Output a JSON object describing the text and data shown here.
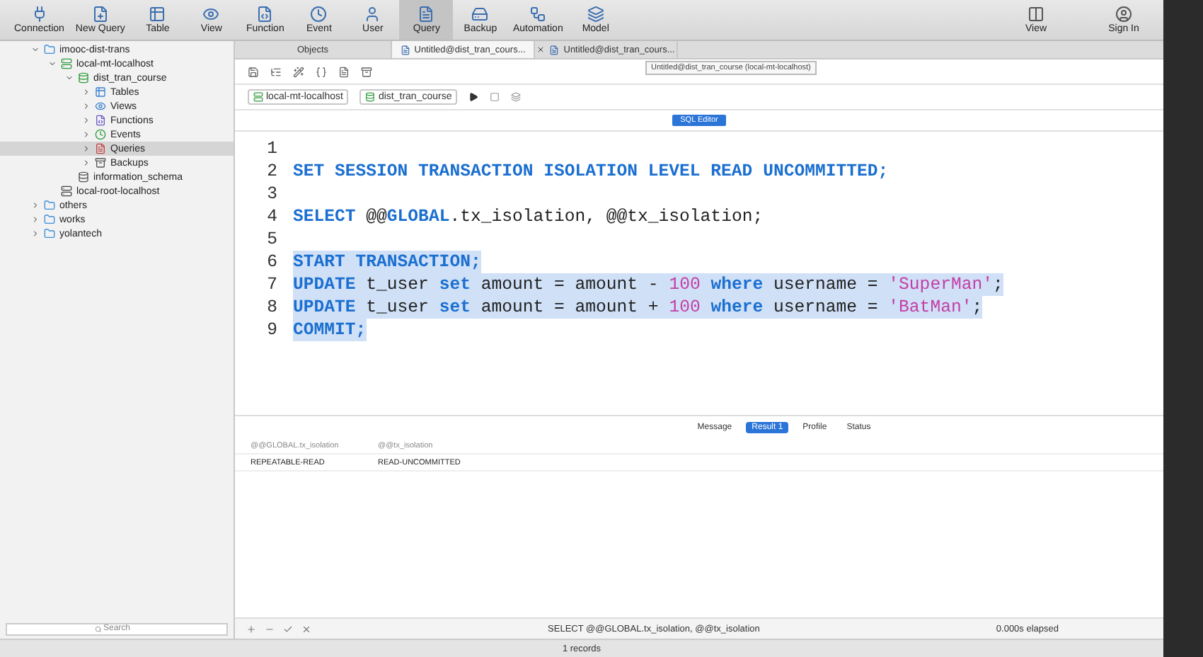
{
  "toolbar": {
    "buttons": [
      {
        "label": "Connection",
        "kind": "plug",
        "selected": false
      },
      {
        "label": "New Query",
        "kind": "newquery",
        "selected": false
      },
      {
        "label": "Table",
        "kind": "table",
        "selected": false
      },
      {
        "label": "View",
        "kind": "view",
        "selected": false
      },
      {
        "label": "Function",
        "kind": "function",
        "selected": false
      },
      {
        "label": "Event",
        "kind": "event",
        "selected": false
      },
      {
        "label": "User",
        "kind": "user",
        "selected": false
      },
      {
        "label": "Query",
        "kind": "query",
        "selected": true
      },
      {
        "label": "Backup",
        "kind": "backup",
        "selected": false
      },
      {
        "label": "Automation",
        "kind": "automation",
        "selected": false
      },
      {
        "label": "Model",
        "kind": "model",
        "selected": false
      }
    ],
    "right_buttons": [
      {
        "label": "View",
        "kind": "layout"
      },
      {
        "label": "Sign In",
        "kind": "signin"
      }
    ]
  },
  "sidebar": {
    "items": [
      {
        "label": "imooc-dist-trans",
        "kind": "folder",
        "expanded": true,
        "selected": false,
        "children": [
          {
            "label": "local-mt-localhost",
            "kind": "connection",
            "expanded": true,
            "selected": false,
            "children": [
              {
                "label": "dist_tran_course",
                "kind": "database",
                "expanded": true,
                "selected": false,
                "children": [
                  {
                    "label": "Tables",
                    "kind": "tables",
                    "expanded": false,
                    "selected": false
                  },
                  {
                    "label": "Views",
                    "kind": "views",
                    "expanded": false,
                    "selected": false
                  },
                  {
                    "label": "Functions",
                    "kind": "functions",
                    "expanded": false,
                    "selected": false
                  },
                  {
                    "label": "Events",
                    "kind": "events",
                    "expanded": false,
                    "selected": false
                  },
                  {
                    "label": "Queries",
                    "kind": "queries",
                    "expanded": false,
                    "selected": true
                  },
                  {
                    "label": "Backups",
                    "kind": "backups",
                    "expanded": false,
                    "selected": false
                  }
                ]
              },
              {
                "label": "information_schema",
                "kind": "schema",
                "selected": false
              }
            ]
          },
          {
            "label": "local-root-localhost",
            "kind": "connection-off",
            "selected": false
          }
        ]
      },
      {
        "label": "others",
        "kind": "folder",
        "expanded": false,
        "selected": false
      },
      {
        "label": "works",
        "kind": "folder",
        "expanded": false,
        "selected": false
      },
      {
        "label": "yolantech",
        "kind": "folder",
        "expanded": false,
        "selected": false
      }
    ],
    "search": {
      "placeholder": "Search"
    }
  },
  "tabs": [
    {
      "label": "Objects",
      "selected": false,
      "closable": false
    },
    {
      "label": "Untitled@dist_tran_cours...",
      "selected": true,
      "closable": false
    },
    {
      "label": "Untitled@dist_tran_cours...",
      "selected": false,
      "closable": true
    }
  ],
  "tooltip": "Untitled@dist_tran_course (local-mt-localhost)",
  "connection": {
    "server": "local-mt-localhost",
    "database": "dist_tran_course"
  },
  "editor_label": "SQL Editor",
  "code_lines": [
    {
      "number": "1"
    },
    {
      "number": "2",
      "selected": false,
      "tokens": [
        {
          "kind": "keyword",
          "text": "SET SESSION TRANSACTION ISOLATION LEVEL READ UNCOMMITTED;"
        }
      ]
    },
    {
      "number": "3"
    },
    {
      "number": "4",
      "selected": false,
      "tokens": [
        {
          "kind": "keyword",
          "text": "SELECT"
        },
        {
          "kind": "plain",
          "text": " @@"
        },
        {
          "kind": "keyword",
          "text": "GLOBAL"
        },
        {
          "kind": "plain",
          "text": ".tx_isolation, @@tx_isolation;"
        }
      ]
    },
    {
      "number": "5"
    },
    {
      "number": "6",
      "selected": true,
      "tokens": [
        {
          "kind": "keyword",
          "text": "START TRANSACTION;"
        }
      ]
    },
    {
      "number": "7",
      "selected": true,
      "tokens": [
        {
          "kind": "keyword",
          "text": "UPDATE"
        },
        {
          "kind": "plain",
          "text": " t_user "
        },
        {
          "kind": "keyword",
          "text": "set"
        },
        {
          "kind": "plain",
          "text": " amount = amount - "
        },
        {
          "kind": "number",
          "text": "100"
        },
        {
          "kind": "keyword",
          "text": " where"
        },
        {
          "kind": "plain",
          "text": " username = "
        },
        {
          "kind": "string",
          "text": "'SuperMan'"
        },
        {
          "kind": "plain",
          "text": ";"
        }
      ]
    },
    {
      "number": "8",
      "selected": true,
      "tokens": [
        {
          "kind": "keyword",
          "text": "UPDATE"
        },
        {
          "kind": "plain",
          "text": " t_user "
        },
        {
          "kind": "keyword",
          "text": "set"
        },
        {
          "kind": "plain",
          "text": " amount = amount + "
        },
        {
          "kind": "number",
          "text": "100"
        },
        {
          "kind": "keyword",
          "text": " where"
        },
        {
          "kind": "plain",
          "text": " username = "
        },
        {
          "kind": "string",
          "text": "'BatMan'"
        },
        {
          "kind": "plain",
          "text": ";"
        }
      ]
    },
    {
      "number": "9",
      "selected": true,
      "tokens": [
        {
          "kind": "keyword",
          "text": "COMMIT;"
        }
      ]
    }
  ],
  "result_tabs": [
    {
      "label": "Message",
      "selected": false
    },
    {
      "label": "Result 1",
      "selected": true
    },
    {
      "label": "Profile",
      "selected": false
    },
    {
      "label": "Status",
      "selected": false
    }
  ],
  "table": {
    "columns": [
      "@@GLOBAL.tx_isolation",
      "@@tx_isolation"
    ],
    "rows": [
      [
        "REPEATABLE-READ",
        "READ-UNCOMMITTED"
      ]
    ]
  },
  "status_bar": {
    "query": "SELECT @@GLOBAL.tx_isolation, @@tx_isolation",
    "elapsed": "0.000s elapsed",
    "records": "1 records"
  }
}
